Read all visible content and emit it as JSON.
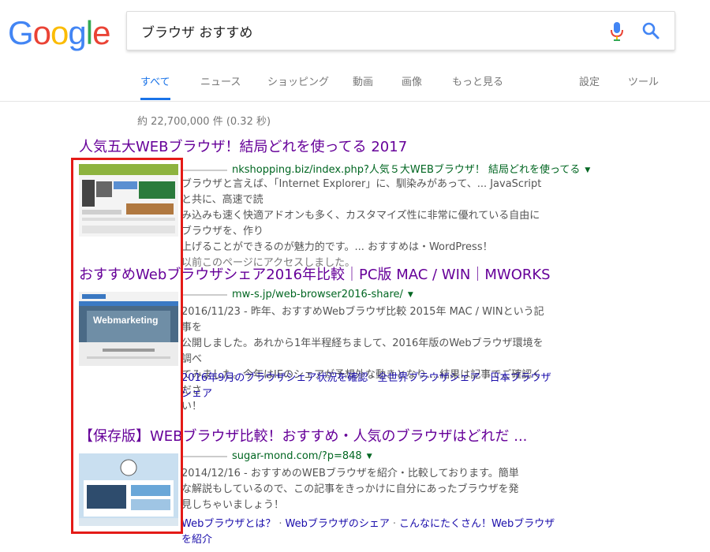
{
  "logo": {
    "letters": [
      "G",
      "o",
      "o",
      "g",
      "l",
      "e"
    ],
    "colors": [
      "#4285f4",
      "#ea4335",
      "#fbbc05",
      "#4285f4",
      "#34a853",
      "#ea4335"
    ]
  },
  "search": {
    "query": "ブラウザ おすすめ",
    "mic_icon": "mic-icon",
    "search_icon": "magnifier-icon"
  },
  "tabs": {
    "items": [
      {
        "label": "すべて",
        "active": true
      },
      {
        "label": "ニュース"
      },
      {
        "label": "ショッピング"
      },
      {
        "label": "動画"
      },
      {
        "label": "画像"
      },
      {
        "label": "もっと見る"
      }
    ],
    "settings": "設定",
    "tools": "ツール"
  },
  "stats": "約 22,700,000 件  (0.32 秒)",
  "results": [
    {
      "title": "人気五大WEBブラウザ！結局どれを使ってる 2017",
      "url": "nkshopping.biz/index.php?人気５大WEBブラウザ！ 結局どれを使ってる",
      "snippet_lines": [
        "ブラウザと言えば、「Internet Explorer」に、馴染みがあって、... JavaScriptと共に、高速で読",
        "み込みも速く快適アドオンも多く、カスタマイズ性に非常に優れている自由にブラウザを、作り",
        "上げることができるのが魅力的です。... おすすめは・WordPress！"
      ],
      "visited_note": "以前このページにアクセスしました。"
    },
    {
      "title": "おすすめWebブラウザシェア2016年比較｜PC版 MAC / WIN｜MWORKS",
      "url": "mw-s.jp/web-browser2016-share/",
      "snippet_lines": [
        "2016/11/23 - 昨年、おすすめWebブラウザ比較 2015年 MAC / WINという記事を",
        "公開しました。あれから1年半程経ちまして、2016年版のWebブラウザ環境を調べ",
        "てみました。今年はIEのシェアが予想外な動きとなり....結果は記事でご確認くださ",
        "い！"
      ],
      "sitelinks": [
        "2016年9月のブラウザシェア状況を確認",
        "全世界ブラウザシェア",
        "日本ブラウザシェア"
      ],
      "thumb_text": "Webmarketing"
    },
    {
      "title": "【保存版】WEBブラウザ比較！おすすめ・人気のブラウザはどれだ ...",
      "url": "sugar-mond.com/?p=848",
      "snippet_lines": [
        "2014/12/16 - おすすめのWEBブラウザを紹介・比較しております。簡単",
        "な解説もしているので、この記事をきっかけに自分にあったブラウザを発",
        "見しちゃいましょう！"
      ],
      "sitelinks": [
        "Webブラウザとは？",
        "Webブラウザのシェア",
        "こんなにたくさん！Webブラウザを紹介"
      ]
    }
  ],
  "highlight_color": "#e41b17"
}
